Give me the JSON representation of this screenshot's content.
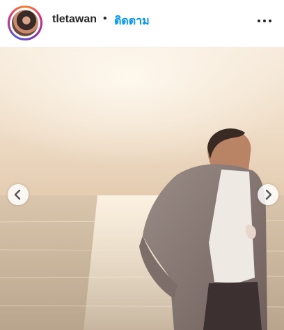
{
  "post": {
    "username": "tletawan",
    "separator": "•",
    "follow_label": "ติดตาม"
  },
  "icons": {
    "more": "more-horizontal-icon",
    "prev": "chevron-left-icon",
    "next": "chevron-right-icon"
  },
  "colors": {
    "follow": "#0095f6",
    "text": "#262626"
  }
}
